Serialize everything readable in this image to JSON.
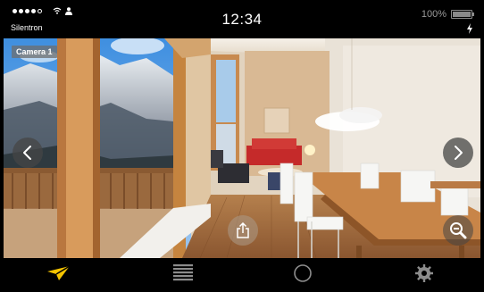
{
  "status_bar": {
    "carrier": "Silentron",
    "time": "12:34",
    "battery_percent": "100%",
    "battery_level": 1.0,
    "signal_bars_filled": 4,
    "signal_bars_total": 5
  },
  "camera": {
    "label": "Camera 1"
  },
  "controls": {
    "prev_icon": "chevron-left-icon",
    "next_icon": "chevron-right-icon",
    "share_icon": "share-icon",
    "zoom_icon": "zoom-out-icon"
  },
  "tabbar": {
    "items": [
      {
        "icon": "send-icon",
        "active": true
      },
      {
        "icon": "list-icon",
        "active": false
      },
      {
        "icon": "circle-icon",
        "active": false
      },
      {
        "icon": "gear-icon",
        "active": false
      }
    ]
  },
  "colors": {
    "active_tab": "#f5c400",
    "inactive_tab": "#8c8c8c",
    "background": "#000000"
  }
}
